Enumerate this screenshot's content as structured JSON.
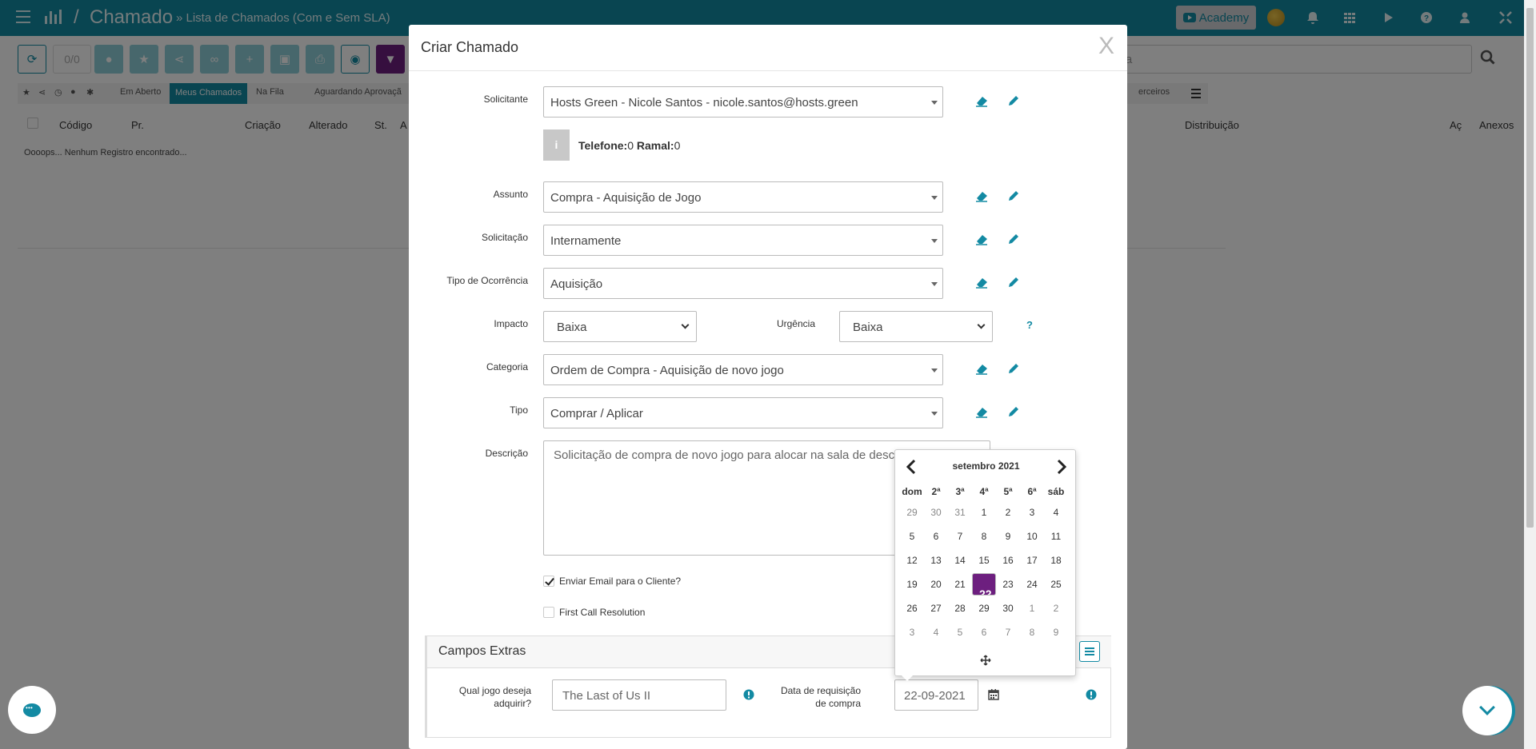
{
  "topbar": {
    "app_title": "Chamado",
    "separator": "/",
    "breadcrumb": "» Lista de Chamados (Com e Sem SLA)",
    "academy_label": "Academy"
  },
  "background": {
    "counter": "0/0",
    "search_placeholder_tail": "isa",
    "filters": [
      "Em Aberto",
      "Meus Chamados",
      "Na Fila",
      "Aguardando Aprovaçã",
      "erceiros"
    ],
    "columns": [
      "Código",
      "Pr.",
      "Criação",
      "Alterado",
      "St.",
      "A",
      "Distribuição",
      "Aç",
      "Anexos"
    ],
    "empty_message": "Oooops... Nenhum Registro encontrado..."
  },
  "modal": {
    "title": "Criar Chamado",
    "close": "X",
    "fields": {
      "solicitante": {
        "label": "Solicitante",
        "value": "Hosts Green - Nicole Santos - nicole.santos@hosts.green"
      },
      "phone_label": "Telefone:",
      "phone_value": "0",
      "ramal_label": "Ramal:",
      "ramal_value": "0",
      "info_glyph": "i",
      "assunto": {
        "label": "Assunto",
        "value": "Compra - Aquisição de Jogo"
      },
      "solicitacao": {
        "label": "Solicitação",
        "value": "Internamente"
      },
      "tipo_ocorrencia": {
        "label": "Tipo de Ocorrência",
        "value": "Aquisição"
      },
      "impacto": {
        "label": "Impacto",
        "value": "Baixa"
      },
      "urgencia": {
        "label": "Urgência",
        "value": "Baixa"
      },
      "help": "?",
      "categoria": {
        "label": "Categoria",
        "value": "Ordem de Compra - Aquisição de novo jogo"
      },
      "tipo": {
        "label": "Tipo",
        "value": "Comprar / Aplicar"
      },
      "descricao": {
        "label": "Descrição",
        "value": "Solicitação de compra de novo jogo para alocar na sala de descanso"
      }
    },
    "checkboxes": {
      "email": {
        "label": "Enviar Email para o Cliente?",
        "checked": true
      },
      "fcr": {
        "label": "First Call Resolution",
        "checked": false
      }
    },
    "extras": {
      "title": "Campos Extras",
      "jogo": {
        "label_line1": "Qual jogo deseja",
        "label_line2": "adquirir?",
        "value": "The Last of Us II"
      },
      "data": {
        "label_line1": "Data de requisição",
        "label_line2": "de compra",
        "value": "22-09-2021"
      }
    }
  },
  "datepicker": {
    "month": "setembro 2021",
    "dow": [
      "dom",
      "2ª",
      "3ª",
      "4ª",
      "5ª",
      "6ª",
      "sáb"
    ],
    "weeks": [
      [
        "29",
        "30",
        "31",
        "1",
        "2",
        "3",
        "4"
      ],
      [
        "5",
        "6",
        "7",
        "8",
        "9",
        "10",
        "11"
      ],
      [
        "12",
        "13",
        "14",
        "15",
        "16",
        "17",
        "18"
      ],
      [
        "19",
        "20",
        "21",
        "22",
        "23",
        "24",
        "25"
      ],
      [
        "26",
        "27",
        "28",
        "29",
        "30",
        "1",
        "2"
      ],
      [
        "3",
        "4",
        "5",
        "6",
        "7",
        "8",
        "9"
      ]
    ],
    "selected": "22"
  },
  "colors": {
    "primary": "#138aa3",
    "accent": "#6d1f7f"
  }
}
